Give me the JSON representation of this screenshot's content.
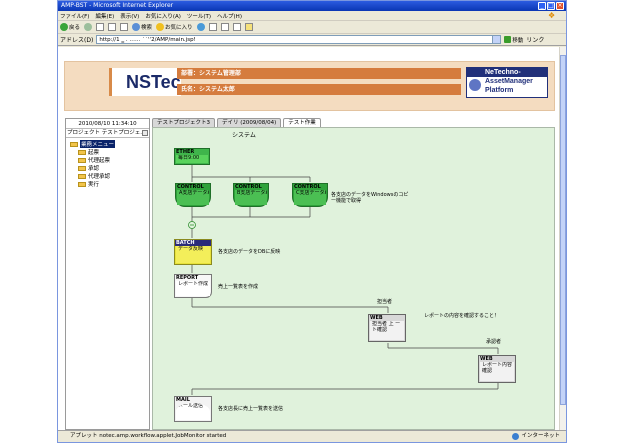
{
  "window": {
    "title": "AMP-BST - Microsoft Internet Explorer",
    "controls": [
      "_",
      "□",
      "×"
    ]
  },
  "menu": [
    "ファイル(F)",
    "編集(E)",
    "表示(V)",
    "お気に入り(A)",
    "ツール(T)",
    "ヘルプ(H)"
  ],
  "toolbar": {
    "back": "戻る",
    "search": "検索",
    "favorites": "お気に入り"
  },
  "address": {
    "label": "アドレス(D)",
    "url": "http://1 ‗ . ‥‥‥  ˙˙ʼʼ2/AMP/main.jsp!",
    "go": "移動",
    "links": "リンク"
  },
  "banner": {
    "logo": "NSTec",
    "dept": "部署：システム管理部",
    "name": "氏名：システム太郎",
    "product_line1": "NeTechno-",
    "product_line2": "AssetManager",
    "product_line3": "Platform"
  },
  "sidebar": {
    "datetime": "2010/08/10 11:34:10",
    "project_select": "プロジェクト テストプロジェ...",
    "root": "業務メニュー",
    "items": [
      "起票",
      "代理起票",
      "承認",
      "代理承認",
      "実行"
    ]
  },
  "tabs": [
    "テストプロジェクト3",
    "デイリ (2009/08/04)",
    "テスト作業"
  ],
  "canvas": {
    "title": "システム",
    "jobs": {
      "ether": {
        "tag": "ETHER",
        "body": "毎日9:00"
      },
      "ctl1": {
        "tag": "CONTROL",
        "body": "A支店データ取得"
      },
      "ctl2": {
        "tag": "CONTROL",
        "body": "B支店データ取得"
      },
      "ctl3": {
        "tag": "CONTROL",
        "body": "C支店データ取得"
      },
      "batch": {
        "tag": "BATCH",
        "body": "データ反映"
      },
      "report": {
        "tag": "REPORT",
        "body": "レポート作成"
      },
      "web1": {
        "tag": "WEB",
        "body": "担当者 上 ート確認"
      },
      "web2": {
        "tag": "WEB",
        "body": "レポート内容確認"
      },
      "mail": {
        "tag": "MAIL",
        "body": "メール送信"
      }
    },
    "notes": {
      "ctl": "各支店のデータをWindowsのコピー機能で取得",
      "batch": "各支店のデータをDBに反映",
      "report": "売上一覧表を作成",
      "person1": "担当者",
      "web_note": "レポートの内容を確認すること！",
      "person2": "承認者",
      "mail": "各支店長に売上一覧表を送信"
    }
  },
  "status": {
    "text": "アプレット notec.amp.workflow.applet.JobMonitor started",
    "zone": "インターネット"
  }
}
